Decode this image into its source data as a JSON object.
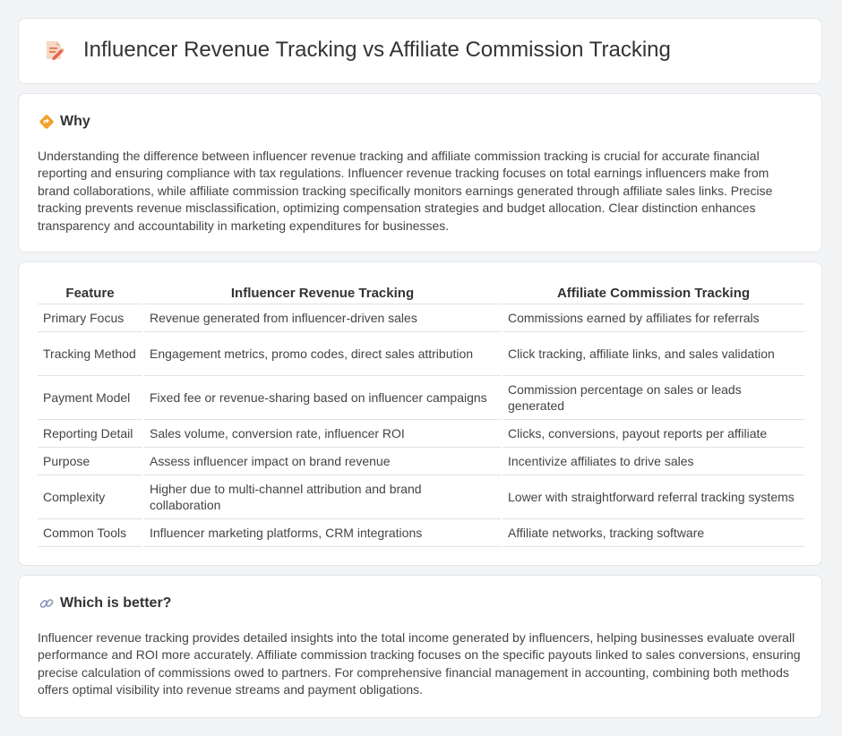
{
  "header": {
    "title": "Influencer Revenue Tracking vs Affiliate Commission Tracking",
    "icon": "document-pencil-icon"
  },
  "why": {
    "icon": "diamond-direction-icon",
    "heading": "Why",
    "body": "Understanding the difference between influencer revenue tracking and affiliate commission tracking is crucial for accurate financial reporting and ensuring compliance with tax regulations. Influencer revenue tracking focuses on total earnings influencers make from brand collaborations, while affiliate commission tracking specifically monitors earnings generated through affiliate sales links. Precise tracking prevents revenue misclassification, optimizing compensation strategies and budget allocation. Clear distinction enhances transparency and accountability in marketing expenditures for businesses."
  },
  "table": {
    "headers": [
      "Feature",
      "Influencer Revenue Tracking",
      "Affiliate Commission Tracking"
    ],
    "rows": [
      [
        "Primary Focus",
        "Revenue generated from influencer-driven sales",
        "Commissions earned by affiliates for referrals"
      ],
      [
        "Tracking Method",
        "Engagement metrics, promo codes, direct sales attribution",
        "Click tracking, affiliate links, and sales validation"
      ],
      [
        "Payment Model",
        "Fixed fee or revenue-sharing based on influencer campaigns",
        "Commission percentage on sales or leads generated"
      ],
      [
        "Reporting Detail",
        "Sales volume, conversion rate, influencer ROI",
        "Clicks, conversions, payout reports per affiliate"
      ],
      [
        "Purpose",
        "Assess influencer impact on brand revenue",
        "Incentivize affiliates to drive sales"
      ],
      [
        "Complexity",
        "Higher due to multi-channel attribution and brand collaboration",
        "Lower with straightforward referral tracking systems"
      ],
      [
        "Common Tools",
        "Influencer marketing platforms, CRM integrations",
        "Affiliate networks, tracking software"
      ]
    ]
  },
  "better": {
    "icon": "link-icon",
    "heading": "Which is better?",
    "body": "Influencer revenue tracking provides detailed insights into the total income generated by influencers, helping businesses evaluate overall performance and ROI more accurately. Affiliate commission tracking focuses on the specific payouts linked to sales conversions, ensuring precise calculation of commissions owed to partners. For comprehensive financial management in accounting, combining both methods offers optimal visibility into revenue streams and payment obligations."
  }
}
